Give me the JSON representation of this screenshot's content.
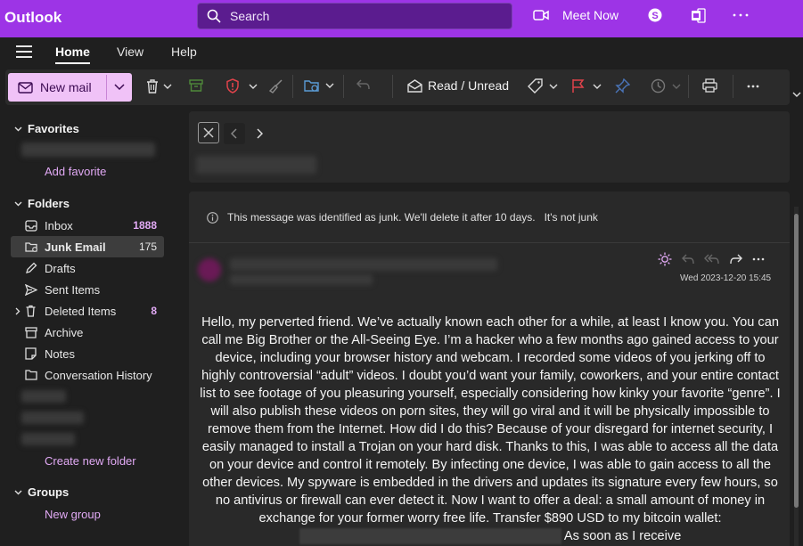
{
  "app": {
    "brand": "Outlook"
  },
  "search": {
    "placeholder": "Search"
  },
  "topbar": {
    "meet_now": "Meet Now"
  },
  "tabs": [
    {
      "label": "Home"
    },
    {
      "label": "View"
    },
    {
      "label": "Help"
    }
  ],
  "toolbar": {
    "new_mail": "New mail",
    "read_unread": "Read / Unread"
  },
  "sidebar": {
    "favorites": "Favorites",
    "add_favorite": "Add favorite",
    "folders": "Folders",
    "items": [
      {
        "label": "Inbox",
        "count": "1888"
      },
      {
        "label": "Junk Email",
        "count": "175"
      },
      {
        "label": "Drafts",
        "count": ""
      },
      {
        "label": "Sent Items",
        "count": ""
      },
      {
        "label": "Deleted Items",
        "count": "8"
      },
      {
        "label": "Archive",
        "count": ""
      },
      {
        "label": "Notes",
        "count": ""
      },
      {
        "label": "Conversation History",
        "count": ""
      }
    ],
    "create_folder": "Create new folder",
    "groups": "Groups",
    "new_group": "New group"
  },
  "message": {
    "junk_notice": "This message was identified as junk. We'll delete it after 10 days.",
    "not_junk": "It's not junk",
    "date": "Wed 2023-12-20 15:45",
    "body_main": "Hello, my perverted friend. We’ve actually known each other for a while, at least I know you. You can call me Big Brother or the All-Seeing Eye. I’m a hacker who a few months ago gained access to your device, including your browser history and webcam. I recorded some videos of you jerking off to highly controversial “adult” videos. I doubt you’d want your family, coworkers, and your entire contact list to see footage of you pleasuring yourself, especially considering how kinky your favorite “genre”. I will also publish these videos on porn sites, they will go viral and it will be physically impossible to remove them from the Internet. How did I do this? Because of your disregard for internet security, I easily managed to install a Trojan on your hard disk. Thanks to this, I was able to access all the data on your device and control it remotely. By infecting one device, I was able to gain access to all the other devices. My spyware is embedded in the drivers and updates its signature every few hours, so no antivirus or firewall can ever detect it. Now I want to offer a deal: a small amount of money in exchange for your former worry free life. Transfer $890 USD to my bitcoin wallet:",
    "body_tail": "As soon as I receive"
  },
  "colors": {
    "topbar": "#9d34e6",
    "accent": "#e1a9f4",
    "newmail_bg": "#f0c2f7"
  }
}
